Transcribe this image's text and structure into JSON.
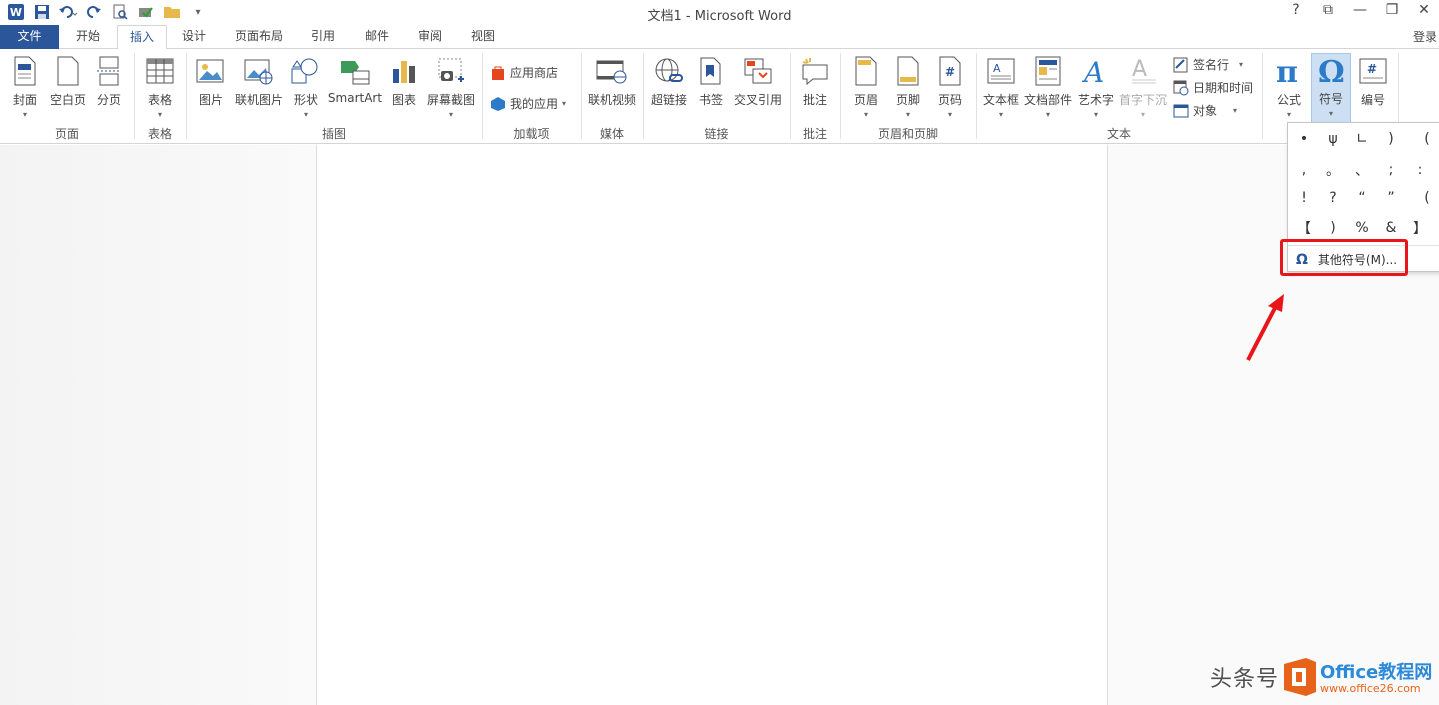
{
  "window": {
    "title": "文档1 - Microsoft Word",
    "controls": [
      "?",
      "⧉",
      "—",
      "❐",
      "✕"
    ]
  },
  "tabs": {
    "file": "文件",
    "items": [
      "开始",
      "插入",
      "设计",
      "页面布局",
      "引用",
      "邮件",
      "审阅",
      "视图"
    ],
    "active": "插入",
    "signin": "登录"
  },
  "ribbon": {
    "pages": {
      "cover": "封面",
      "blank": "空白页",
      "break": "分页",
      "group": "页面"
    },
    "tables": {
      "table": "表格",
      "group": "表格"
    },
    "illustrations": {
      "picture": "图片",
      "online_picture": "联机图片",
      "shapes": "形状",
      "smartart": "SmartArt",
      "chart": "图表",
      "screenshot": "屏幕截图",
      "group": "插图"
    },
    "addins": {
      "store": "应用商店",
      "my_apps": "我的应用",
      "group": "加载项"
    },
    "media": {
      "online_video": "联机视频",
      "group": "媒体"
    },
    "links": {
      "hyperlink": "超链接",
      "bookmark": "书签",
      "cross_ref": "交叉引用",
      "group": "链接"
    },
    "comments": {
      "comment": "批注",
      "group": "批注"
    },
    "header_footer": {
      "header": "页眉",
      "footer": "页脚",
      "page_number": "页码",
      "group": "页眉和页脚"
    },
    "text": {
      "textbox": "文本框",
      "quick_parts": "文档部件",
      "wordart": "艺术字",
      "dropcap": "首字下沉",
      "signature": "签名行",
      "datetime": "日期和时间",
      "object": "对象",
      "group": "文本"
    },
    "symbols": {
      "equation": "公式",
      "symbol": "符号",
      "number": "编号"
    }
  },
  "symbol_dropdown": {
    "symbols": [
      "•",
      "ψ",
      "∟",
      ")",
      "(",
      ",",
      "。",
      "、",
      ";",
      ":",
      "!",
      "?",
      "“",
      "”",
      "(",
      "【",
      ")",
      "%",
      "&",
      "】"
    ],
    "more_label": "其他符号(M)..."
  },
  "watermark": {
    "text": "头条号",
    "brand": "Office教程网",
    "url": "www.office26.com"
  },
  "colors": {
    "accent": "#2b579a",
    "highlight": "#e8161b"
  }
}
